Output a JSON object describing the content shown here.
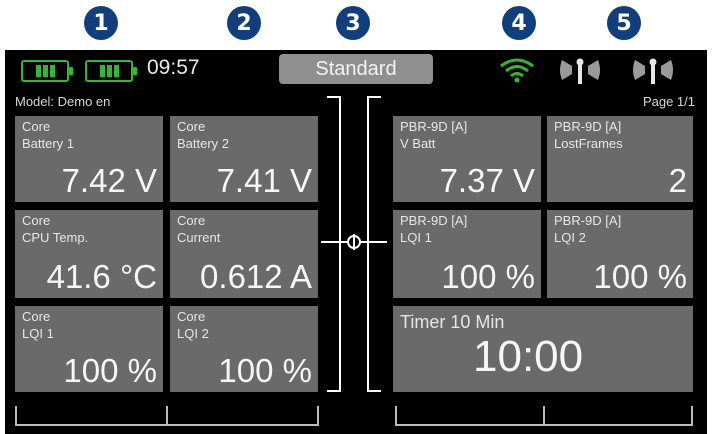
{
  "callouts": [
    "1",
    "2",
    "3",
    "4",
    "5"
  ],
  "topbar": {
    "time": "09:57",
    "mode": "Standard"
  },
  "model_label": "Model: Demo en",
  "page_label": "Page 1/1",
  "left_tiles": [
    {
      "l1": "Core",
      "l2": "Battery 1",
      "value": "7.42 V"
    },
    {
      "l1": "Core",
      "l2": "Battery 2",
      "value": "7.41 V"
    },
    {
      "l1": "Core",
      "l2": "CPU Temp.",
      "value": "41.6 °C"
    },
    {
      "l1": "Core",
      "l2": "Current",
      "value": "0.612 A"
    },
    {
      "l1": "Core",
      "l2": "LQI 1",
      "value": "100 %"
    },
    {
      "l1": "Core",
      "l2": "LQI 2",
      "value": "100 %"
    }
  ],
  "right_tiles": [
    {
      "l1": "PBR-9D [A]",
      "l2": "V Batt",
      "value": "7.37 V"
    },
    {
      "l1": "PBR-9D [A]",
      "l2": "LostFrames",
      "value": "2"
    },
    {
      "l1": "PBR-9D [A]",
      "l2": "LQI 1",
      "value": "100 %"
    },
    {
      "l1": "PBR-9D [A]",
      "l2": "LQI 2",
      "value": "100 %"
    }
  ],
  "timer": {
    "label": "Timer 10 Min",
    "value": "10:00"
  },
  "icons": {
    "signal": "wifi-signal-icon",
    "antenna": "antenna-icon"
  },
  "colors": {
    "callout": "#123f7c",
    "battery": "#2fbb2f",
    "signal": "#2fbb2f",
    "tile": "#6a6a6a"
  }
}
